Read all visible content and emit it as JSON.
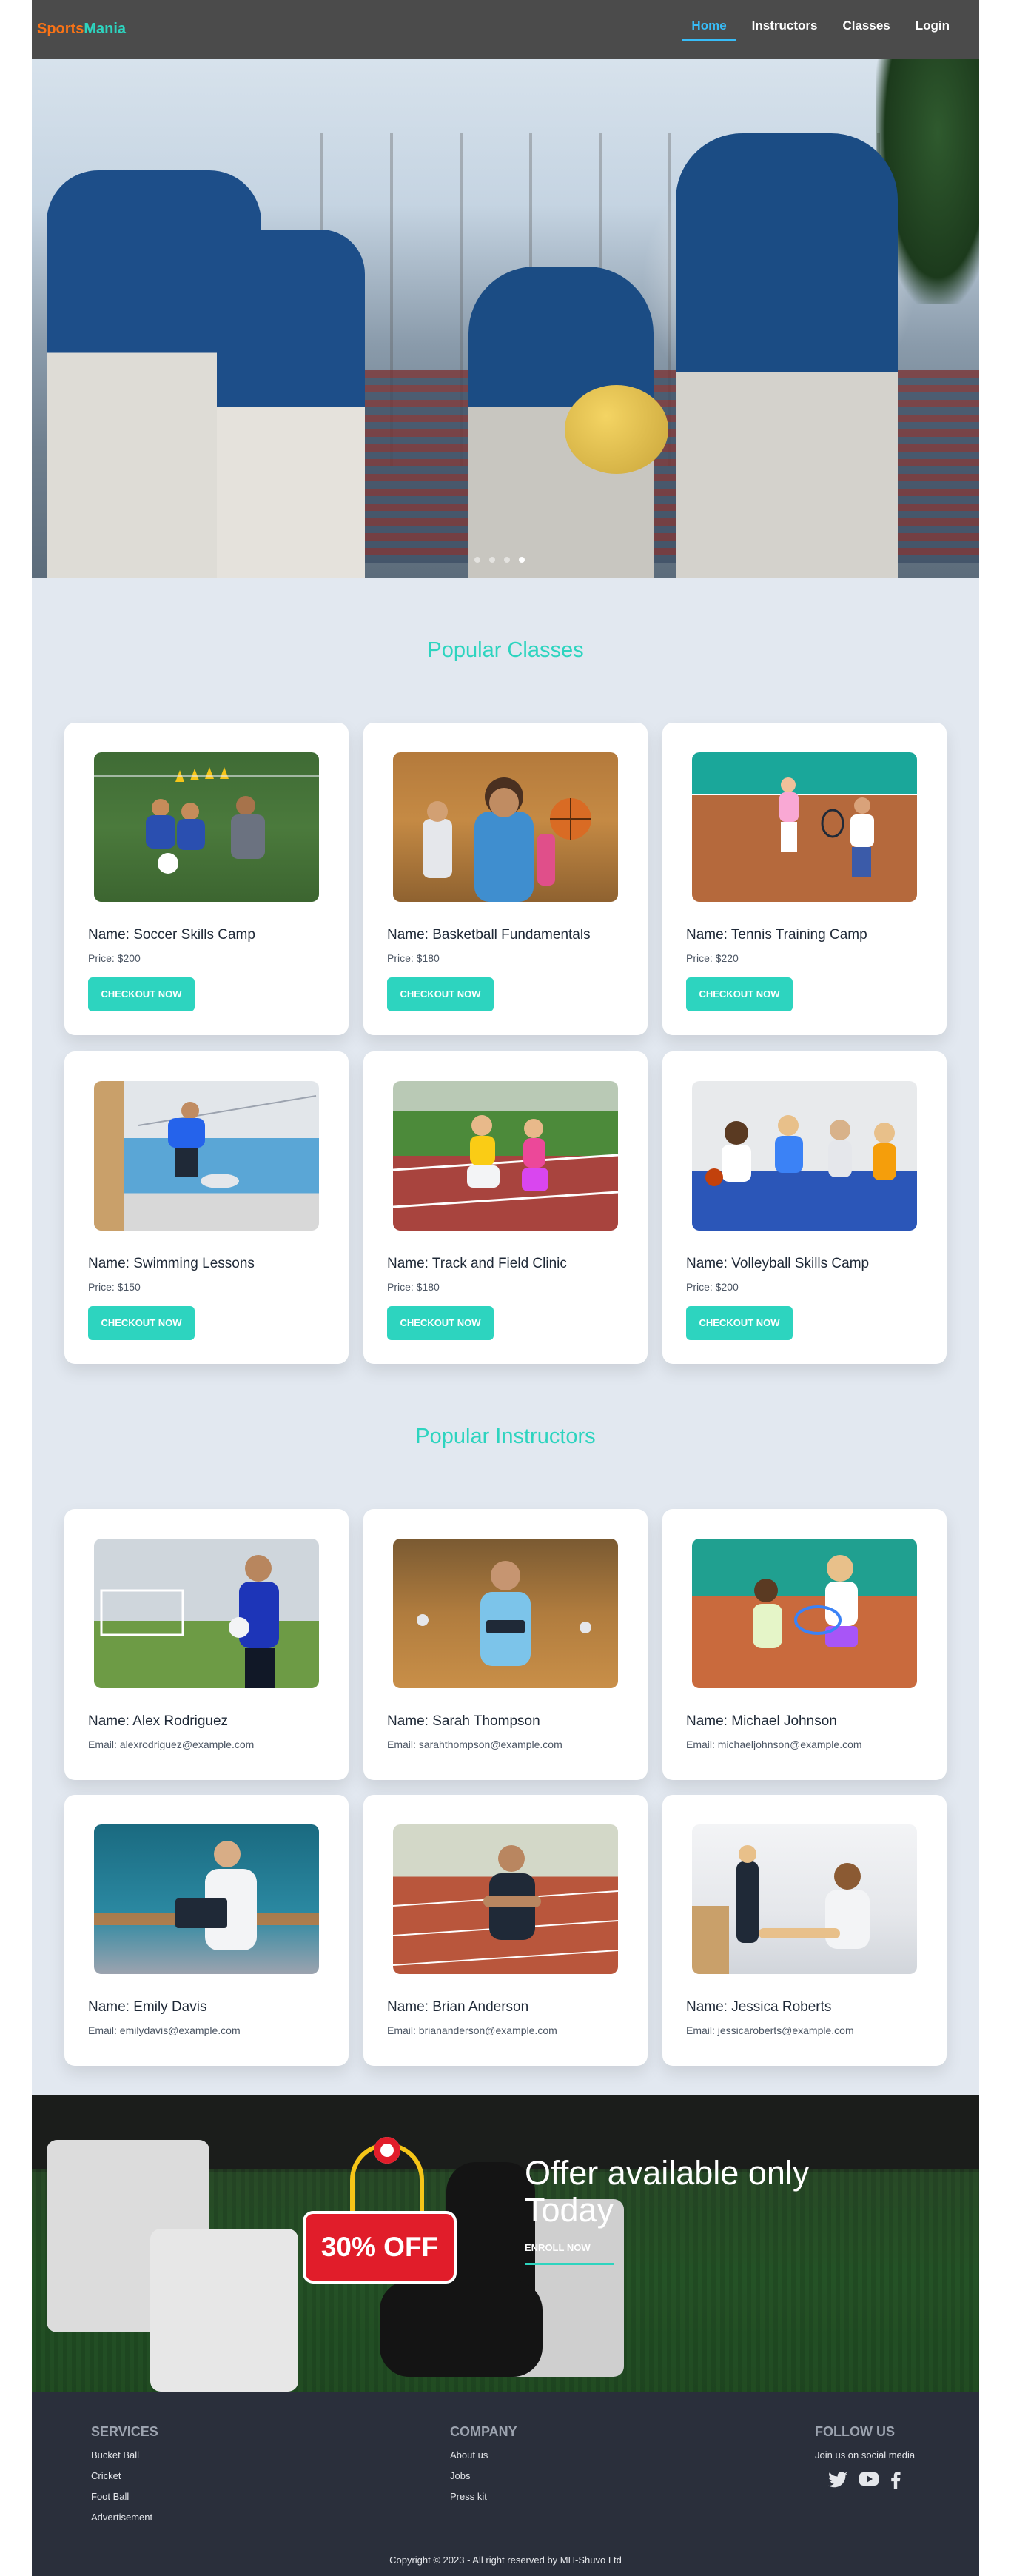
{
  "nav": {
    "logo_part1": "Sports",
    "logo_part2": "Mania",
    "items": [
      {
        "label": "Home",
        "active": true
      },
      {
        "label": "Instructors",
        "active": false
      },
      {
        "label": "Classes",
        "active": false
      },
      {
        "label": "Login",
        "active": false
      }
    ]
  },
  "hero": {
    "image_icon": "baseball-team-photo",
    "slides_count": 4,
    "active_slide": 4
  },
  "classes": {
    "title": "Popular Classes",
    "button_label": "CHECKOUT NOW",
    "items": [
      {
        "name": "Name: Soccer Skills Camp",
        "price": "Price: $200",
        "image_icon": "soccer-kids-photo"
      },
      {
        "name": "Name: Basketball Fundamentals",
        "price": "Price: $180",
        "image_icon": "basketball-kids-photo"
      },
      {
        "name": "Name: Tennis Training Camp",
        "price": "Price: $220",
        "image_icon": "tennis-kids-photo"
      },
      {
        "name": "Name: Swimming Lessons",
        "price": "Price: $150",
        "image_icon": "swimming-pool-photo"
      },
      {
        "name": "Name: Track and Field Clinic",
        "price": "Price: $180",
        "image_icon": "track-kids-photo"
      },
      {
        "name": "Name: Volleyball Skills Camp",
        "price": "Price: $200",
        "image_icon": "volleyball-kids-photo"
      }
    ]
  },
  "instructors": {
    "title": "Popular Instructors",
    "items": [
      {
        "name": "Name: Alex Rodriguez",
        "email": "Email: alexrodriguez@example.com",
        "image_icon": "soccer-coach-photo"
      },
      {
        "name": "Name: Sarah Thompson",
        "email": "Email: sarahthompson@example.com",
        "image_icon": "gym-coach-photo"
      },
      {
        "name": "Name: Michael Johnson",
        "email": "Email: michaeljohnson@example.com",
        "image_icon": "tennis-coach-photo"
      },
      {
        "name": "Name: Emily Davis",
        "email": "Email: emilydavis@example.com",
        "image_icon": "swim-coach-photo"
      },
      {
        "name": "Name: Brian Anderson",
        "email": "Email: briananderson@example.com",
        "image_icon": "track-coach-photo"
      },
      {
        "name": "Name: Jessica Roberts",
        "email": "Email: jessicaroberts@example.com",
        "image_icon": "gymnastics-coach-photo"
      }
    ]
  },
  "offer": {
    "badge": "30% OFF",
    "title": "Offer available only Today",
    "button_label": "ENROLL NOW"
  },
  "footer": {
    "services": {
      "title": "SERVICES",
      "links": [
        "Bucket Ball",
        "Cricket",
        "Foot Ball",
        "Advertisement"
      ]
    },
    "company": {
      "title": "COMPANY",
      "links": [
        "About us",
        "Jobs",
        "Press kit"
      ]
    },
    "follow": {
      "title": "FOLLOW US",
      "text": "Join us on social media",
      "icons": [
        "twitter-icon",
        "youtube-icon",
        "facebook-icon"
      ]
    },
    "copyright": "Copyright © 2023 - All right reserved by MH-Shuvo Ltd"
  },
  "colors": {
    "accent": "#2dd4bf",
    "logo_orange": "#f97316",
    "nav_active": "#38bdf8",
    "navbar_bg": "#4b4b4b",
    "page_bg": "#e2e8f0",
    "footer_bg": "#2a2f3b"
  }
}
